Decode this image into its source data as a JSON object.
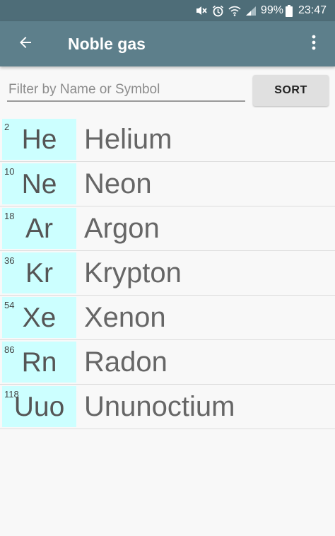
{
  "status_bar": {
    "battery": "99%",
    "time": "23:47",
    "icons": [
      "mute-icon",
      "alarm-icon",
      "wifi-icon",
      "signal-icon",
      "battery-icon"
    ]
  },
  "app_bar": {
    "title": "Noble gas",
    "back_icon": "arrow-left-icon",
    "menu_icon": "more-vertical-icon"
  },
  "filter": {
    "placeholder": "Filter by Name or Symbol",
    "value": "",
    "sort_label": "SORT"
  },
  "colors": {
    "app_bar": "#5d7f8b",
    "status_bar": "#4e6d78",
    "tile": "#ccffff"
  },
  "elements": [
    {
      "number": "2",
      "symbol": "He",
      "name": "Helium"
    },
    {
      "number": "10",
      "symbol": "Ne",
      "name": "Neon"
    },
    {
      "number": "18",
      "symbol": "Ar",
      "name": "Argon"
    },
    {
      "number": "36",
      "symbol": "Kr",
      "name": "Krypton"
    },
    {
      "number": "54",
      "symbol": "Xe",
      "name": "Xenon"
    },
    {
      "number": "86",
      "symbol": "Rn",
      "name": "Radon"
    },
    {
      "number": "118",
      "symbol": "Uuo",
      "name": "Ununoctium"
    }
  ]
}
